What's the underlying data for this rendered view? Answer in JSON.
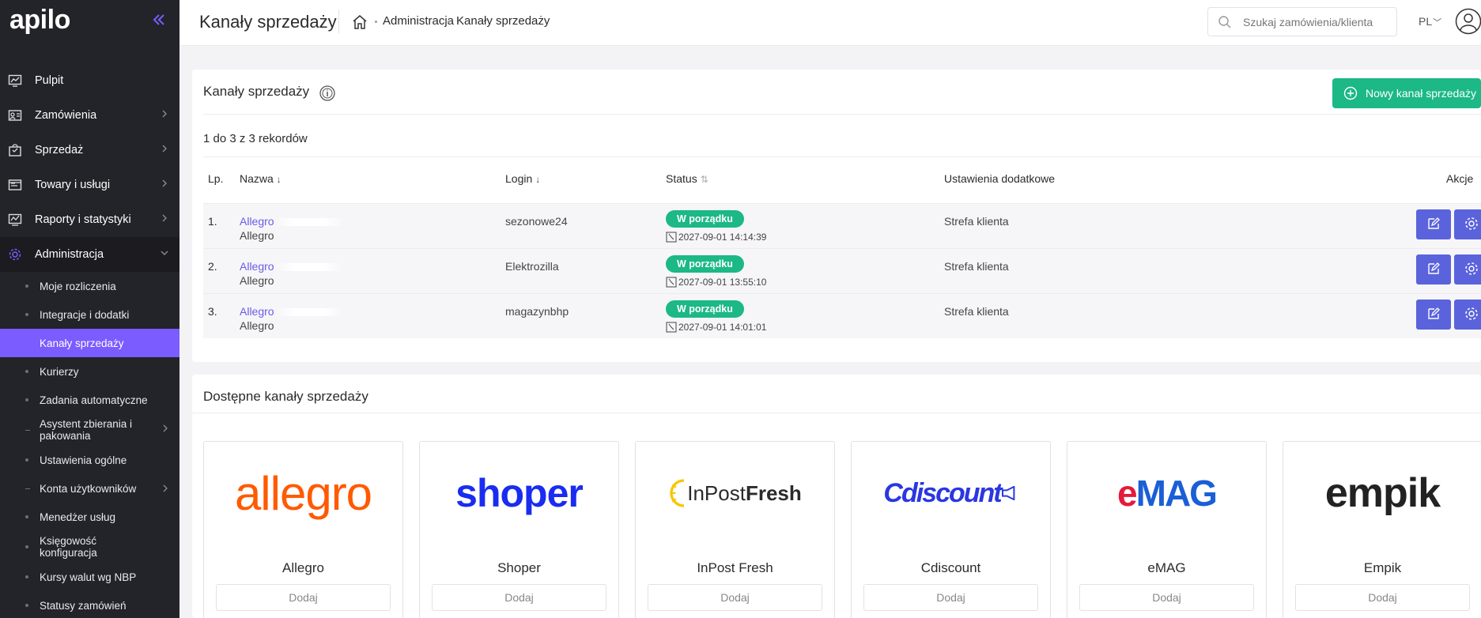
{
  "app": {
    "logo": "apilo"
  },
  "sidebar": {
    "items": [
      {
        "label": "Pulpit"
      },
      {
        "label": "Zamówienia"
      },
      {
        "label": "Sprzedaż"
      },
      {
        "label": "Towary i usługi"
      },
      {
        "label": "Raporty i statystyki"
      },
      {
        "label": "Administracja"
      }
    ],
    "sub": [
      {
        "label": "Moje rozliczenia"
      },
      {
        "label": "Integracje i dodatki"
      },
      {
        "label": "Kanały sprzedaży"
      },
      {
        "label": "Kurierzy"
      },
      {
        "label": "Zadania automatyczne"
      },
      {
        "label": "Asystent zbierania i pakowania"
      },
      {
        "label": "Ustawienia ogólne"
      },
      {
        "label": "Konta użytkowników"
      },
      {
        "label": "Menedżer usług"
      },
      {
        "label": "Księgowość konfiguracja"
      },
      {
        "label": "Kursy walut wg NBP"
      },
      {
        "label": "Statusy zamówień"
      }
    ]
  },
  "topbar": {
    "title": "Kanały sprzedaży",
    "breadcrumb": [
      "Administracja",
      "Kanały sprzedaży"
    ],
    "search_placeholder": "Szukaj zamówienia/klienta",
    "lang": "PL"
  },
  "channels_card": {
    "title": "Kanały sprzedaży",
    "new_button": "Nowy kanał sprzedaży",
    "records": "1 do 3 z 3 rekordów",
    "columns": {
      "lp": "Lp.",
      "name": "Nazwa",
      "login": "Login",
      "status": "Status",
      "extra": "Ustawienia dodatkowe",
      "actions": "Akcje"
    },
    "rows": [
      {
        "lp": "1.",
        "name_prefix": "Allegro",
        "name_tail": "",
        "type": "Allegro",
        "login": "sezonowe24",
        "status": "W porządku",
        "ts": "2027-09-01 14:14:39",
        "extra": "Strefa klienta"
      },
      {
        "lp": "2.",
        "name_prefix": "Allegro",
        "name_tail": "",
        "type": "Allegro",
        "login": "Elektrozilla",
        "status": "W porządku",
        "ts": "2027-09-01 13:55:10",
        "extra": "Strefa klienta"
      },
      {
        "lp": "3.",
        "name_prefix": "Allegro",
        "name_tail": "",
        "type": "Allegro",
        "login": "magazynbhp",
        "status": "W porządku",
        "ts": "2027-09-01 14:01:01",
        "extra": "Strefa klienta"
      }
    ]
  },
  "available_card": {
    "title": "Dostępne kanały sprzedaży",
    "add_label": "Dodaj",
    "tiles": [
      {
        "name": "Allegro",
        "logo_text": "allegro"
      },
      {
        "name": "Shoper",
        "logo_text": "shoper"
      },
      {
        "name": "InPost Fresh",
        "logo_text_a": "InPost",
        "logo_text_b": "Fresh"
      },
      {
        "name": "Cdiscount",
        "logo_text": "Cdiscount"
      },
      {
        "name": "eMAG",
        "logo_text_a": "e",
        "logo_text_b": "MAG"
      },
      {
        "name": "Empik",
        "logo_text": "empik"
      }
    ]
  },
  "colors": {
    "accent": "#7a5cff",
    "success": "#1cb886",
    "action": "#5a63dc",
    "sidebar": "#23232a"
  }
}
